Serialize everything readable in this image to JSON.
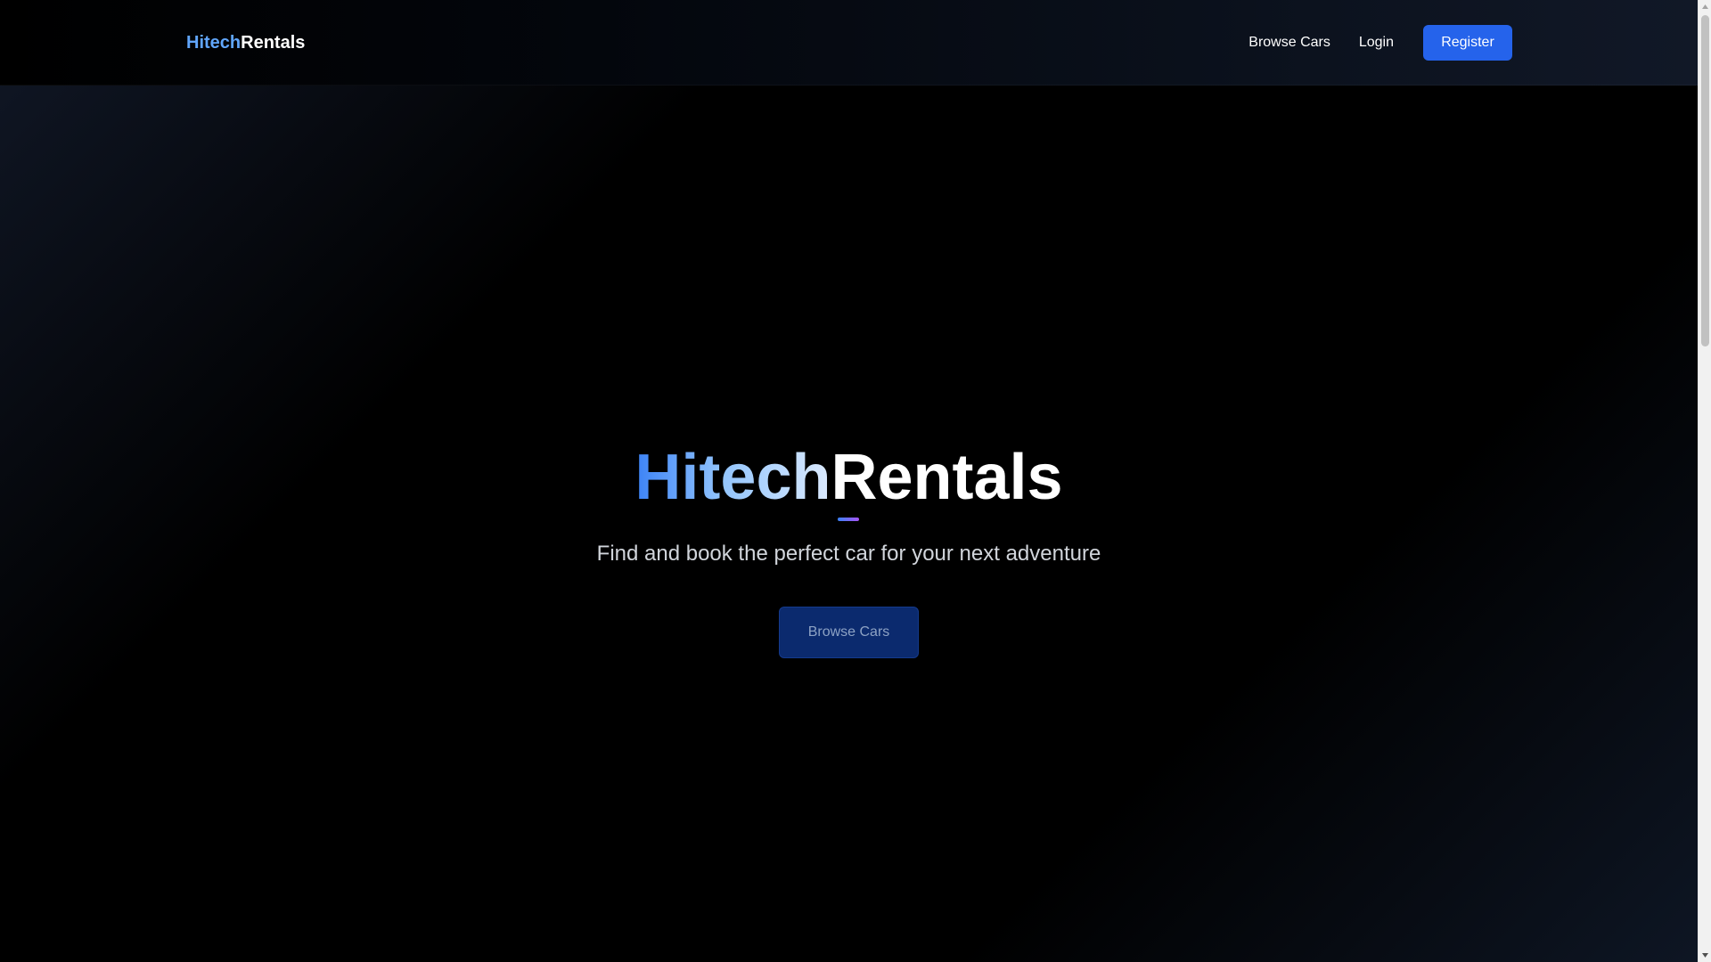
{
  "navbar": {
    "brand_accent": "Hitech",
    "brand_rest": "Rentals",
    "links": {
      "browse_cars": "Browse Cars",
      "login": "Login"
    },
    "register_label": "Register"
  },
  "hero": {
    "title_accent": "Hitech",
    "title_rest": "Rentals",
    "subtitle": "Find and book the perfect car for your next adventure",
    "cta_label": "Browse Cars"
  },
  "colors": {
    "accent_blue": "#2563eb",
    "brand_blue": "#60a5fa",
    "background": "#000000",
    "cta_background": "#0b2a6e"
  },
  "icons": {
    "scroll_up": "triangle-up-icon",
    "scroll_down": "triangle-down-icon"
  }
}
